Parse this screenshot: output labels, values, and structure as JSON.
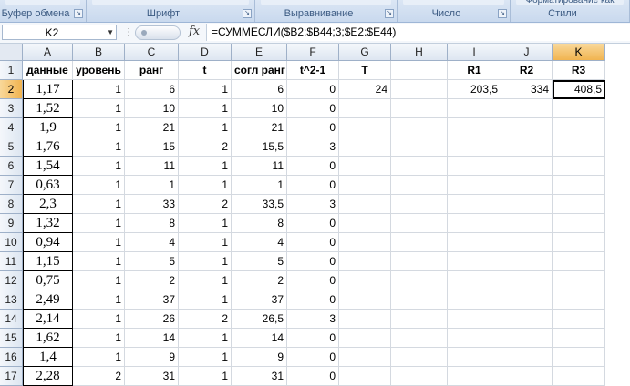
{
  "ribbon": {
    "groups": [
      {
        "label": "Буфер обмена",
        "top": ""
      },
      {
        "label": "Шрифт",
        "top": ""
      },
      {
        "label": "Выравнивание",
        "top": ""
      },
      {
        "label": "Число",
        "top": ""
      },
      {
        "label": "Стили",
        "top": "Форматирование как"
      }
    ]
  },
  "formula_bar": {
    "name_box": "K2",
    "fx_label": "fx",
    "formula": "=СУММЕСЛИ($B2:$B44;3;$E2:$E44)"
  },
  "sheet": {
    "columns": [
      "A",
      "B",
      "C",
      "D",
      "E",
      "F",
      "G",
      "H",
      "I",
      "J",
      "K"
    ],
    "row_numbers": [
      "1",
      "2",
      "3",
      "4",
      "5",
      "6",
      "7",
      "8",
      "9",
      "10",
      "11",
      "12",
      "13",
      "14",
      "15",
      "16",
      "17"
    ],
    "header_row": [
      "данные",
      "уровень",
      "ранг",
      "t",
      "согл ранг",
      "t^2-1",
      "T",
      "",
      "R1",
      "R2",
      "R3"
    ],
    "rows": [
      [
        "1,17",
        "1",
        "6",
        "1",
        "6",
        "0",
        "24",
        "",
        "203,5",
        "334",
        "408,5"
      ],
      [
        "1,52",
        "1",
        "10",
        "1",
        "10",
        "0",
        "",
        "",
        "",
        "",
        ""
      ],
      [
        "1,9",
        "1",
        "21",
        "1",
        "21",
        "0",
        "",
        "",
        "",
        "",
        ""
      ],
      [
        "1,76",
        "1",
        "15",
        "2",
        "15,5",
        "3",
        "",
        "",
        "",
        "",
        ""
      ],
      [
        "1,54",
        "1",
        "11",
        "1",
        "11",
        "0",
        "",
        "",
        "",
        "",
        ""
      ],
      [
        "0,63",
        "1",
        "1",
        "1",
        "1",
        "0",
        "",
        "",
        "",
        "",
        ""
      ],
      [
        "2,3",
        "1",
        "33",
        "2",
        "33,5",
        "3",
        "",
        "",
        "",
        "",
        ""
      ],
      [
        "1,32",
        "1",
        "8",
        "1",
        "8",
        "0",
        "",
        "",
        "",
        "",
        ""
      ],
      [
        "0,94",
        "1",
        "4",
        "1",
        "4",
        "0",
        "",
        "",
        "",
        "",
        ""
      ],
      [
        "1,15",
        "1",
        "5",
        "1",
        "5",
        "0",
        "",
        "",
        "",
        "",
        ""
      ],
      [
        "0,75",
        "1",
        "2",
        "1",
        "2",
        "0",
        "",
        "",
        "",
        "",
        ""
      ],
      [
        "2,49",
        "1",
        "37",
        "1",
        "37",
        "0",
        "",
        "",
        "",
        "",
        ""
      ],
      [
        "2,14",
        "1",
        "26",
        "2",
        "26,5",
        "3",
        "",
        "",
        "",
        "",
        ""
      ],
      [
        "1,62",
        "1",
        "14",
        "1",
        "14",
        "0",
        "",
        "",
        "",
        "",
        ""
      ],
      [
        "1,4",
        "1",
        "9",
        "1",
        "9",
        "0",
        "",
        "",
        "",
        "",
        ""
      ],
      [
        "2,28",
        "2",
        "31",
        "1",
        "31",
        "0",
        "",
        "",
        "",
        "",
        ""
      ]
    ],
    "active_cell": "K2"
  }
}
